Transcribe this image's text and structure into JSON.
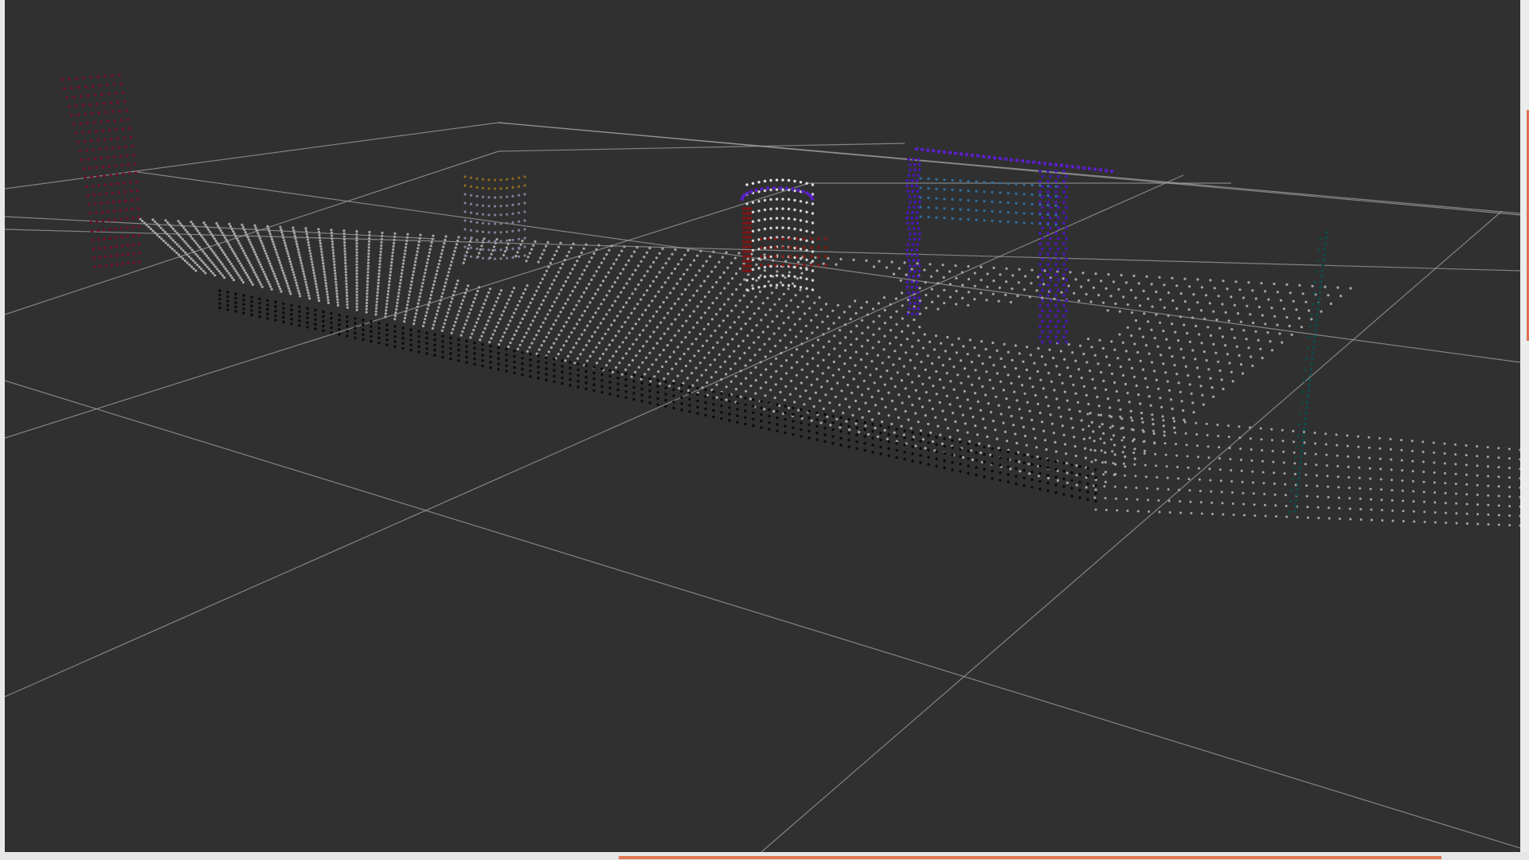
{
  "app": {
    "title": ""
  },
  "colors": {
    "background": "#303030",
    "grid": "#a0a0a0",
    "floor_points": "#a6a6a6",
    "edge_points": "#0a0a0a",
    "accent": "#e07a55"
  },
  "scene": {
    "grid": true,
    "objects": [
      {
        "label": "",
        "color": "#6b1126",
        "shape": "curved-panel"
      },
      {
        "label": "",
        "color": "#8c6a20",
        "shape": "cylinder"
      },
      {
        "label": "",
        "color": "#c8c8c8",
        "shape": "mug"
      },
      {
        "label": "",
        "color": "#7b1515",
        "shape": "mug-side"
      },
      {
        "label": "",
        "color": "#5a1fc8",
        "shape": "box-outline"
      },
      {
        "label": "",
        "color": "#2f6fa0",
        "shape": "box-interior"
      },
      {
        "label": "",
        "color": "#0e4a4a",
        "shape": "pole"
      }
    ]
  },
  "progress": {
    "value": 1.0
  }
}
